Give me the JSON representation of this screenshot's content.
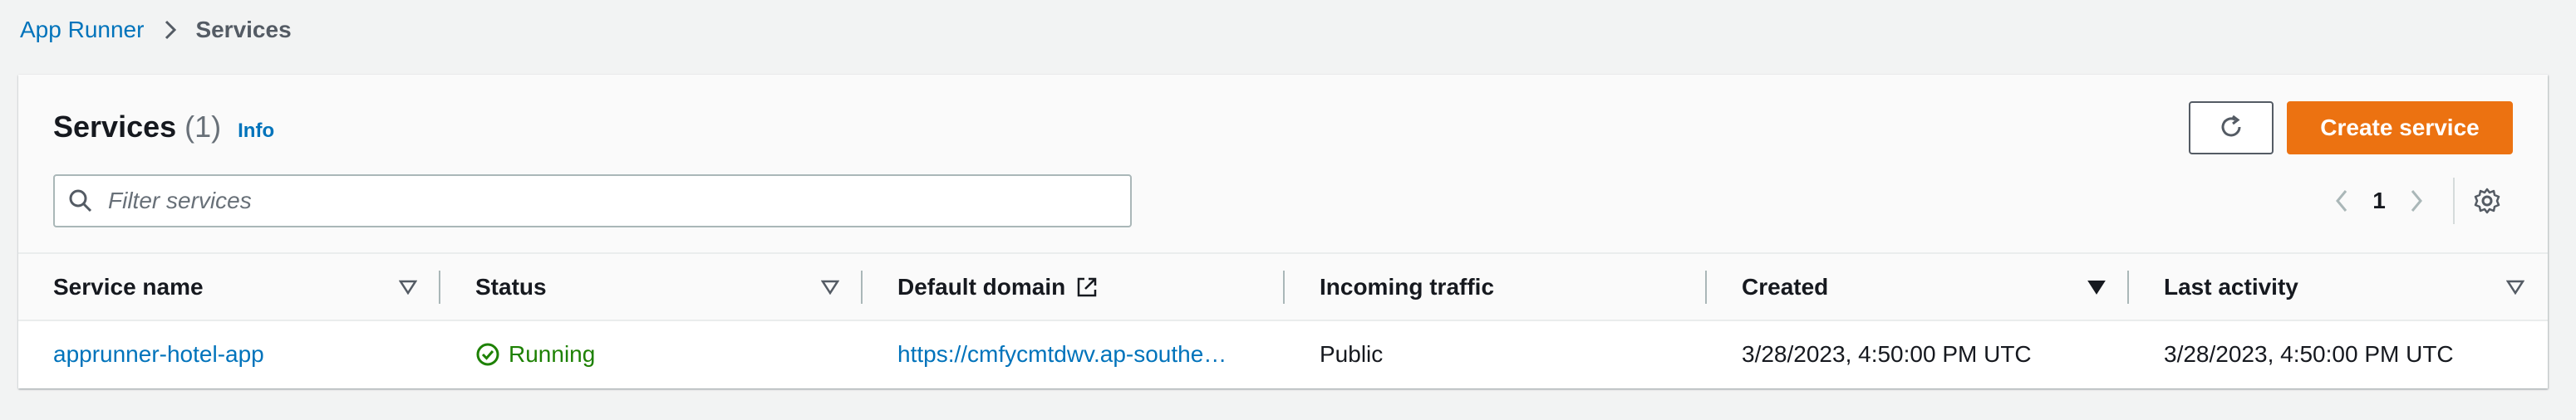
{
  "breadcrumb": {
    "root": "App Runner",
    "current": "Services"
  },
  "panel": {
    "title": "Services",
    "count": "(1)",
    "info": "Info"
  },
  "actions": {
    "refresh_icon": "refresh-icon",
    "create_label": "Create service"
  },
  "filter": {
    "placeholder": "Filter services",
    "value": ""
  },
  "pagination": {
    "current_page": "1"
  },
  "table": {
    "headers": {
      "service_name": "Service name",
      "status": "Status",
      "default_domain": "Default domain",
      "incoming_traffic": "Incoming traffic",
      "created": "Created",
      "last_activity": "Last activity"
    },
    "rows": [
      {
        "service_name": "apprunner-hotel-app",
        "status": "Running",
        "default_domain": "https://cmfycmtdwv.ap-southe…",
        "incoming_traffic": "Public",
        "created": "3/28/2023, 4:50:00 PM UTC",
        "last_activity": "3/28/2023, 4:50:00 PM UTC"
      }
    ]
  },
  "colors": {
    "accent": "#0073bb",
    "primary_button": "#ec7211",
    "success": "#1d8102"
  }
}
